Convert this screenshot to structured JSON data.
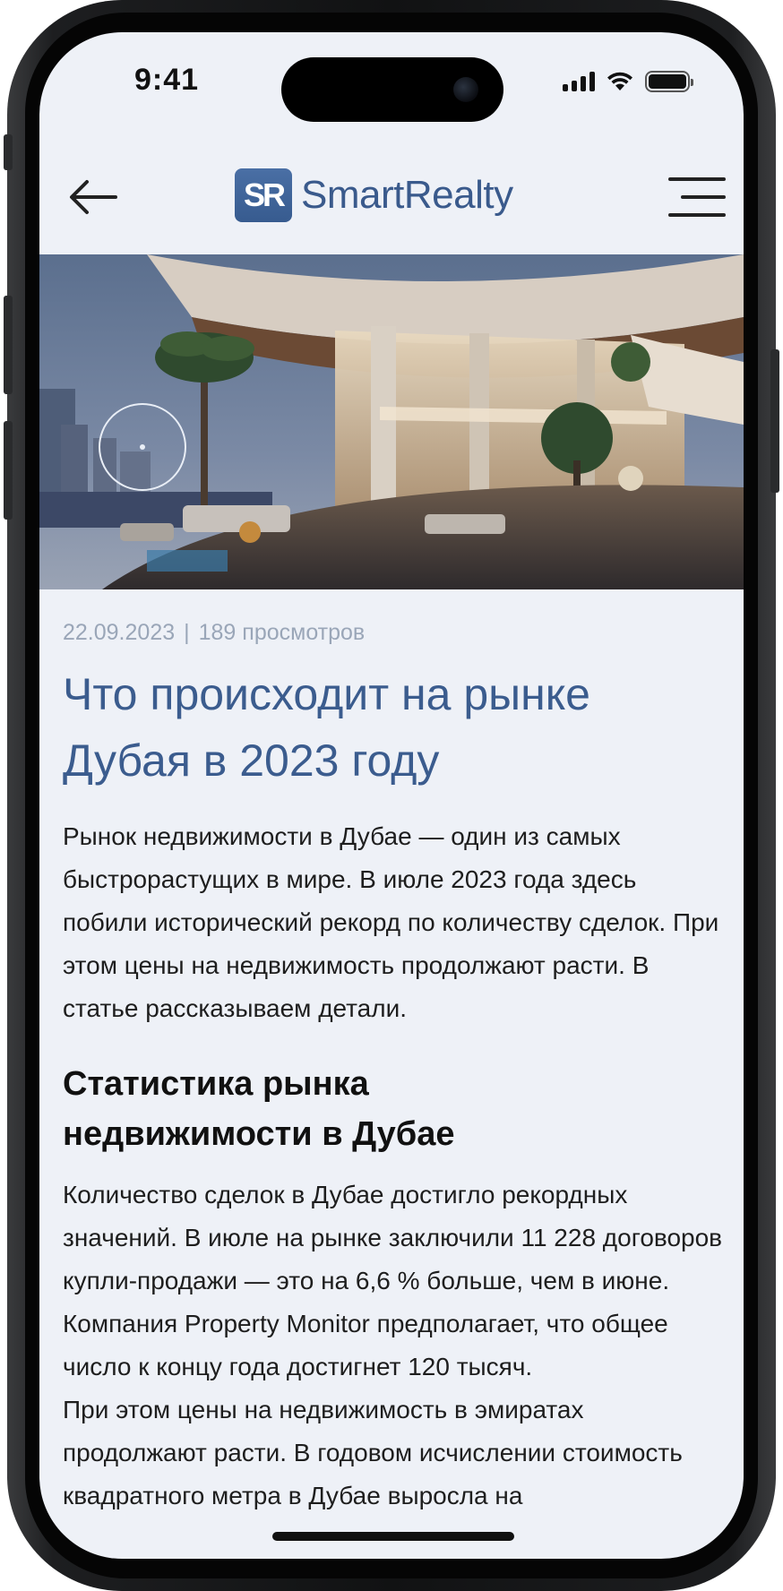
{
  "status_bar": {
    "time": "9:41",
    "icons": [
      "signal-icon",
      "wifi-icon",
      "battery-icon"
    ]
  },
  "header": {
    "back_icon": "arrow-left-icon",
    "logo_mark": "SR",
    "logo_text": "SmartRealty",
    "menu_icon": "hamburger-menu-icon",
    "brand_color": "#3a5a8c"
  },
  "hero": {
    "description_icon": "dubai-villa-photo"
  },
  "article": {
    "date": "22.09.2023",
    "separator": "|",
    "views": "189 просмотров",
    "title": "Что происходит на рынке Дубая в 2023 году",
    "lead": "Рынок недвижимости в Дубае — один из самых быстрорастущих в мире. В июле 2023 года здесь побили исторический рекорд по количеству сделок. При этом цены на недвижимость продолжают расти. В статье рассказываем детали.",
    "section_heading": "Статистика рынка недвижимости в Дубае",
    "paragraph_1": "Количество сделок в Дубае достигло рекордных значений. В июле на рынке заключили 11 228 договоров купли-продажи — это на 6,6 % больше, чем в июне. Компания Property Monitor предполагает, что общее число к концу года достигнет 120 тысяч.",
    "paragraph_2": "При этом цены на недвижимость в эмиратах продолжают расти. В годовом исчислении стоимость квадратного метра в Дубае выросла на"
  },
  "colors": {
    "title": "#3b5c8e",
    "meta": "#9aa6b8",
    "screen_bg": "#eef1f7"
  }
}
